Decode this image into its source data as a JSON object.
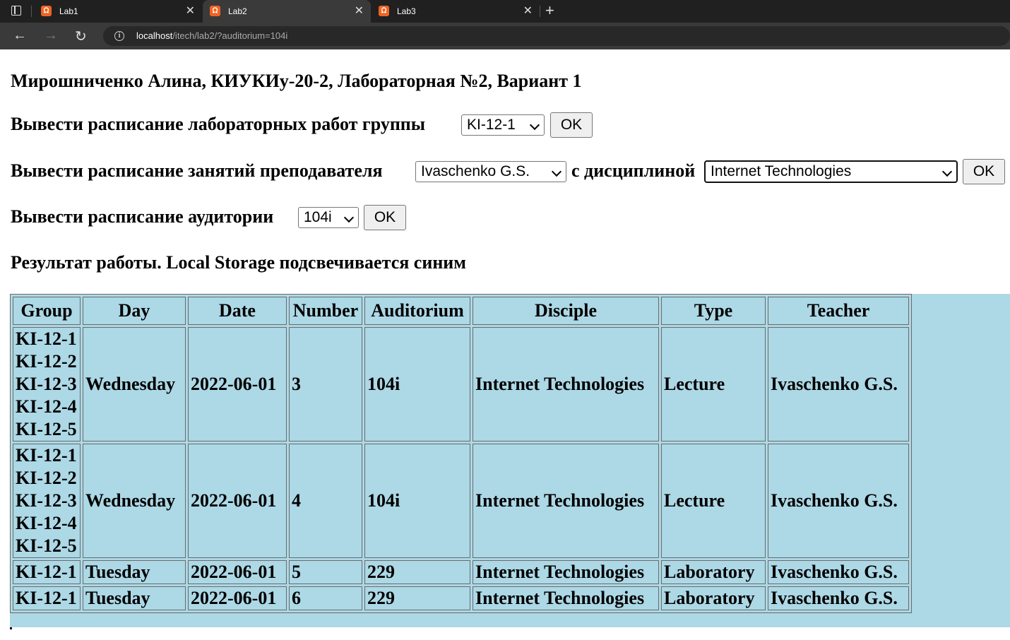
{
  "browser": {
    "tabs": [
      {
        "label": "Lab1",
        "active": false
      },
      {
        "label": "Lab2",
        "active": true
      },
      {
        "label": "Lab3",
        "active": false
      }
    ],
    "url_host": "localhost",
    "url_path": "/itech/lab2/?auditorium=104i"
  },
  "page": {
    "heading": "Мирошниченко Алина, КИУКИу-20-2, Лабораторная №2, Вариант 1",
    "group_query": {
      "label": "Вывести расписание лабораторных работ группы",
      "selected": "KI-12-1",
      "button": "OK"
    },
    "teacher_query": {
      "label": "Вывести расписание занятий преподавателя",
      "selected_teacher": "Ivaschenko G.S.",
      "connector": "с дисциплиной",
      "selected_discipline": "Internet Technologies",
      "button": "OK"
    },
    "auditorium_query": {
      "label": "Вывести расписание аудитории",
      "selected": "104i",
      "button": "OK"
    },
    "result_heading": "Результат работы. Local Storage подсвечивается синим",
    "highlight_color": "#add8e6"
  },
  "table": {
    "headers": [
      "Group",
      "Day",
      "Date",
      "Number",
      "Auditorium",
      "Disciple",
      "Type",
      "Teacher"
    ],
    "rows": [
      {
        "groups": [
          "KI-12-1",
          "KI-12-2",
          "KI-12-3",
          "KI-12-4",
          "KI-12-5"
        ],
        "day": "Wednesday",
        "date": "2022-06-01",
        "number": "3",
        "auditorium": "104i",
        "disciple": "Internet Technologies",
        "type": "Lecture",
        "teacher": "Ivaschenko G.S."
      },
      {
        "groups": [
          "KI-12-1",
          "KI-12-2",
          "KI-12-3",
          "KI-12-4",
          "KI-12-5"
        ],
        "day": "Wednesday",
        "date": "2022-06-01",
        "number": "4",
        "auditorium": "104i",
        "disciple": "Internet Technologies",
        "type": "Lecture",
        "teacher": "Ivaschenko G.S."
      },
      {
        "groups": [
          "KI-12-1"
        ],
        "day": "Tuesday",
        "date": "2022-06-01",
        "number": "5",
        "auditorium": "229",
        "disciple": "Internet Technologies",
        "type": "Laboratory",
        "teacher": "Ivaschenko G.S."
      },
      {
        "groups": [
          "KI-12-1"
        ],
        "day": "Tuesday",
        "date": "2022-06-01",
        "number": "6",
        "auditorium": "229",
        "disciple": "Internet Technologies",
        "type": "Laboratory",
        "teacher": "Ivaschenko G.S."
      }
    ]
  }
}
